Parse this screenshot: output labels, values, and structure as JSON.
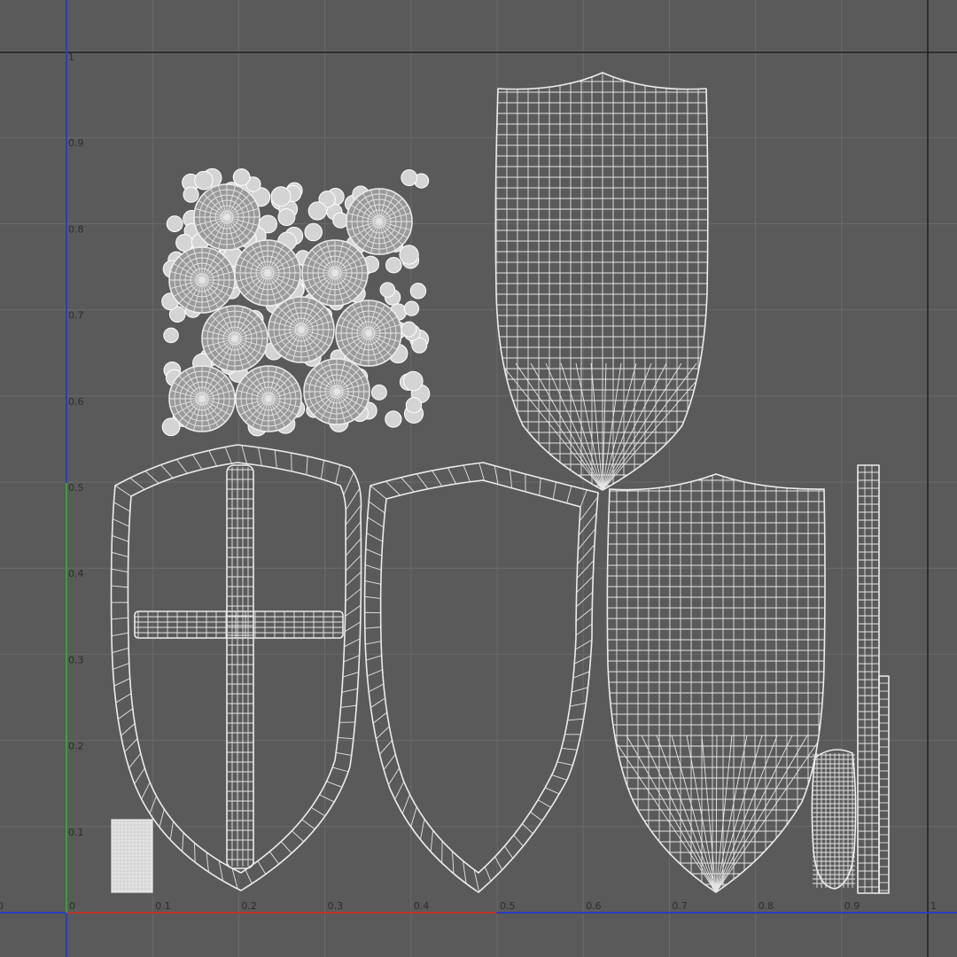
{
  "viewport": {
    "u_ticks": [
      "0",
      "0.1",
      "0.2",
      "0.3",
      "0.4",
      "0.5",
      "0.6",
      "0.7",
      "0.8",
      "0.9",
      "1"
    ],
    "v_ticks": [
      "0.1",
      "0.2",
      "0.3",
      "0.4",
      "0.5",
      "0.6",
      "0.7",
      "0.8",
      "0.9",
      "1"
    ],
    "colors": {
      "background": "#5a5a5a",
      "grid": "#6b6b6b",
      "boundary": "#1e1e1e",
      "u_axis_left": "#c0332b",
      "u_axis_right": "#2b3cbf",
      "v_axis_bottom": "#2ea82e",
      "v_axis_top": "#2b3cbf",
      "wireframe": "#ececec"
    },
    "uv_islands": [
      "rivet-cluster",
      "shield-front-cross",
      "shield-rim",
      "shield-back-top",
      "shield-back-bottom",
      "strap-vertical",
      "handle-piece",
      "small-block"
    ]
  }
}
